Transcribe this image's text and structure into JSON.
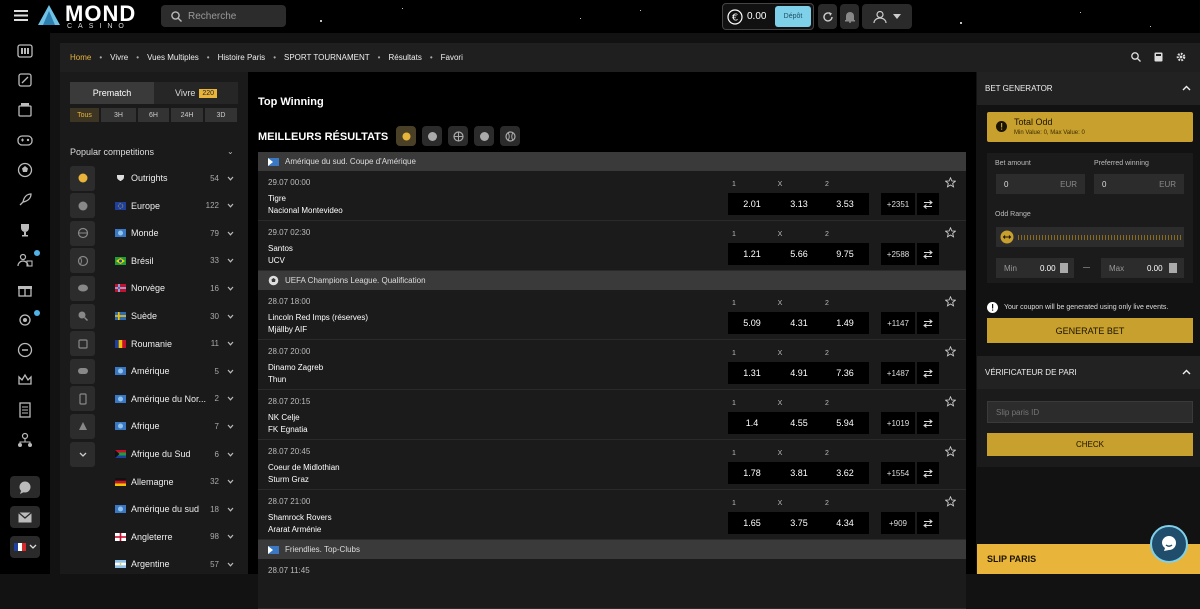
{
  "header": {
    "logo_title": "MOND",
    "logo_sub": "CASINO",
    "search_placeholder": "Recherche",
    "balance": "0.00",
    "deposit_label": "Dépôt"
  },
  "breadcrumbs": [
    "Home",
    "Vivre",
    "Vues Multiples",
    "Histoire Paris",
    "SPORT TOURNAMENT",
    "Résultats",
    "Favori"
  ],
  "left_panel": {
    "tab_prematch": "Prematch",
    "tab_live": "Vivre",
    "live_count": "220",
    "time_filters": [
      "Tous",
      "3H",
      "6H",
      "24H",
      "3D"
    ],
    "popular_title": "Popular competitions",
    "competitions": [
      {
        "name": "Outrights",
        "count": "54",
        "flag": "trophy"
      },
      {
        "name": "Europe",
        "count": "122",
        "flag": "eu"
      },
      {
        "name": "Monde",
        "count": "79",
        "flag": "world"
      },
      {
        "name": "Brésil",
        "count": "33",
        "flag": "br"
      },
      {
        "name": "Norvège",
        "count": "16",
        "flag": "no"
      },
      {
        "name": "Suède",
        "count": "30",
        "flag": "se"
      },
      {
        "name": "Roumanie",
        "count": "11",
        "flag": "ro"
      },
      {
        "name": "Amérique",
        "count": "5",
        "flag": "world"
      },
      {
        "name": "Amérique du Nor...",
        "count": "2",
        "flag": "world"
      },
      {
        "name": "Afrique",
        "count": "7",
        "flag": "world"
      },
      {
        "name": "Afrique du Sud",
        "count": "6",
        "flag": "za"
      },
      {
        "name": "Allemagne",
        "count": "32",
        "flag": "de"
      },
      {
        "name": "Amérique du sud",
        "count": "18",
        "flag": "world"
      },
      {
        "name": "Angleterre",
        "count": "98",
        "flag": "en"
      },
      {
        "name": "Argentine",
        "count": "57",
        "flag": "ar"
      }
    ]
  },
  "main": {
    "title": "Top Winning",
    "section_title": "MEILLEURS RÉSULTATS",
    "odd_headers": [
      "1",
      "X",
      "2"
    ],
    "groups": [
      {
        "league": "Amérique du sud. Coupe d'Amérique",
        "matches": [
          {
            "time": "29.07  00:00",
            "team1": "Tigre",
            "team2": "Nacional Montevideo",
            "odds": [
              "2.01",
              "3.13",
              "3.53"
            ],
            "more": "+2351"
          },
          {
            "time": "29.07  02:30",
            "team1": "Santos",
            "team2": "UCV",
            "odds": [
              "1.21",
              "5.66",
              "9.75"
            ],
            "more": "+2588"
          }
        ]
      },
      {
        "league": "UEFA Champions League. Qualification",
        "matches": [
          {
            "time": "28.07  18:00",
            "team1": "Lincoln Red Imps (réserves)",
            "team2": "Mjällby AIF",
            "odds": [
              "5.09",
              "4.31",
              "1.49"
            ],
            "more": "+1147"
          },
          {
            "time": "28.07  20:00",
            "team1": "Dinamo Zagreb",
            "team2": "Thun",
            "odds": [
              "1.31",
              "4.91",
              "7.36"
            ],
            "more": "+1487"
          },
          {
            "time": "28.07  20:15",
            "team1": "NK Celje",
            "team2": "FK Egnatia",
            "odds": [
              "1.4",
              "4.55",
              "5.94"
            ],
            "more": "+1019"
          },
          {
            "time": "28.07  20:45",
            "team1": "Coeur de Midlothian",
            "team2": "Sturm Graz",
            "odds": [
              "1.78",
              "3.81",
              "3.62"
            ],
            "more": "+1554"
          },
          {
            "time": "28.07  21:00",
            "team1": "Shamrock Rovers",
            "team2": "Ararat Arménie",
            "odds": [
              "1.65",
              "3.75",
              "4.34"
            ],
            "more": "+909"
          }
        ]
      },
      {
        "league": "Friendlies. Top-Clubs",
        "matches": [
          {
            "time": "28.07  11:45",
            "team1": "",
            "team2": "",
            "odds": [
              "",
              "",
              ""
            ],
            "more": ""
          }
        ]
      }
    ]
  },
  "right_panel": {
    "bet_generator_title": "BET GENERATOR",
    "total_odd_title": "Total Odd",
    "total_odd_sub": "Min Value: 0, Max Value: 0",
    "bet_amount_label": "Bet amount",
    "preferred_winning_label": "Preferred winning",
    "bet_amount_value": "0",
    "preferred_winning_value": "0",
    "currency": "EUR",
    "odd_range_label": "Odd Range",
    "min_label": "Min",
    "max_label": "Max",
    "min_value": "0.00",
    "max_value": "0.00",
    "range_sep": "—",
    "coupon_note": "Your coupon will be generated using only live events.",
    "generate_label": "GENERATE BET",
    "checker_title": "VÉRIFICATEUR DE PARI",
    "slip_placeholder": "Slip paris ID",
    "check_label": "CHECK",
    "slip_title": "SLIP PARIS"
  },
  "colors": {
    "accent": "#e8b43a",
    "deposit": "#7fd1ea",
    "bg": "#000000"
  }
}
